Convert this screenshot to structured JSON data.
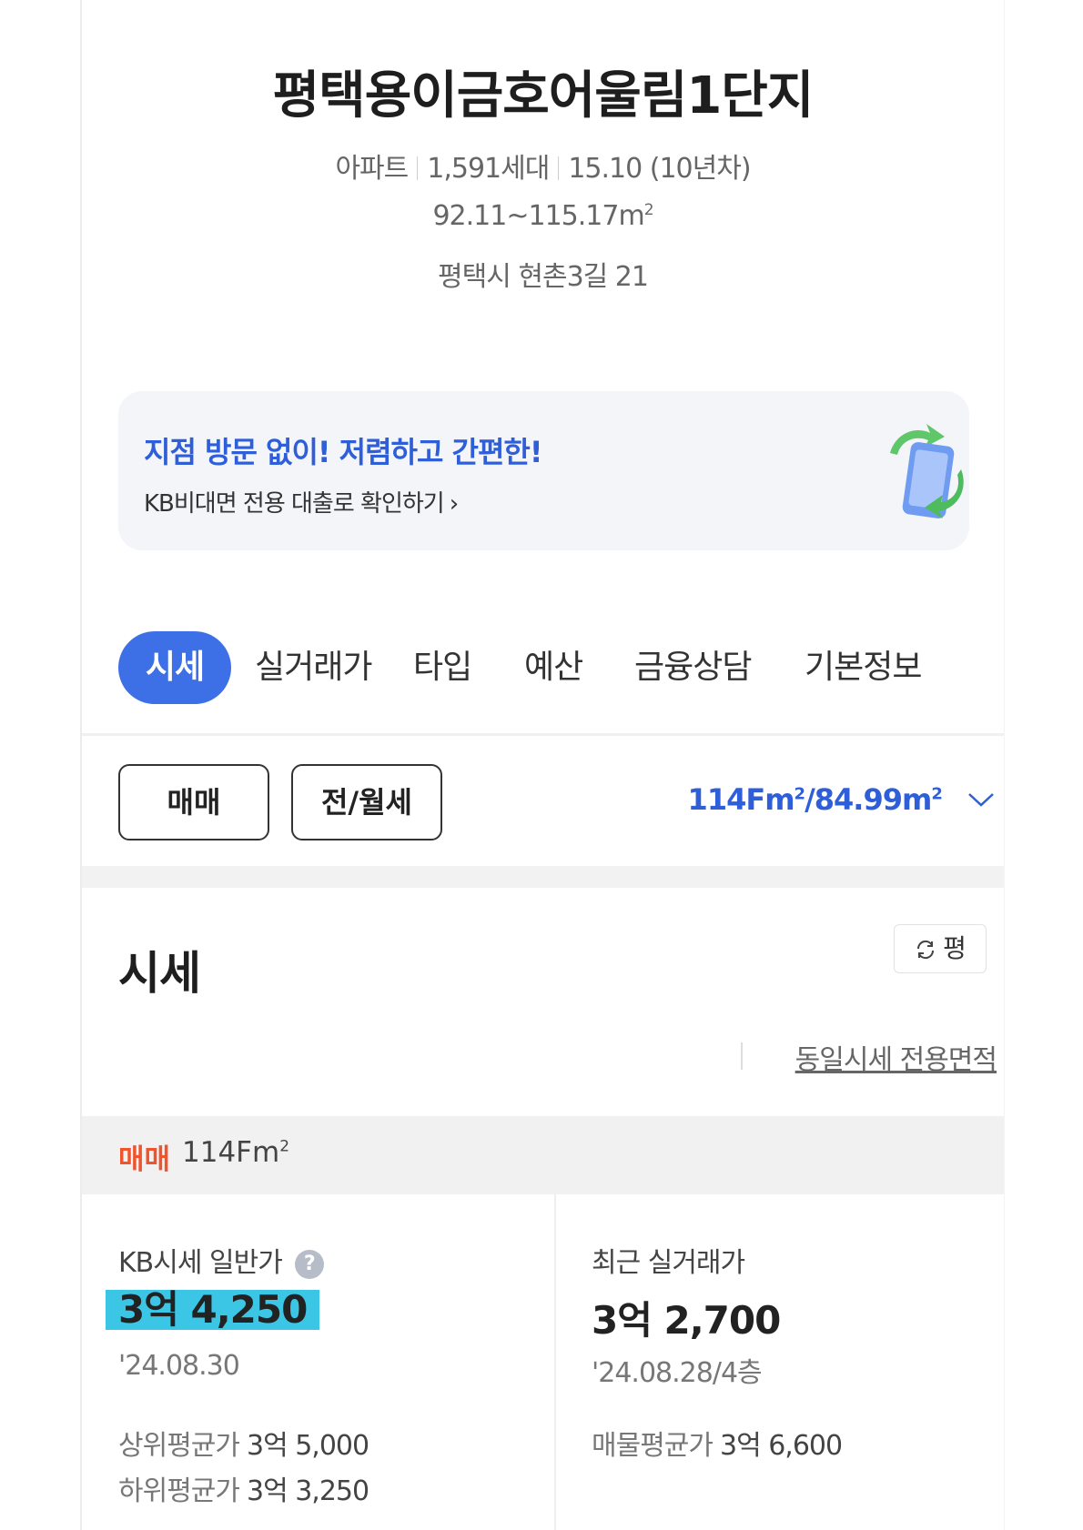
{
  "complex": {
    "name": "평택용이금호어울림1단지",
    "meta": [
      "아파트",
      "1,591세대",
      "15.10 (10년차)"
    ],
    "area_range": "92.11~115.17m",
    "area_unit_sup": "2",
    "address": "평택시 현촌3길 21"
  },
  "banner": {
    "headline": "지점 방문 없이! 저렴하고 간편한!",
    "subline": "KB비대면 전용 대출로 확인하기",
    "chevron": "›",
    "accent_color": "#2f5fd8",
    "illustration": "phone-refresh-icon"
  },
  "tabs": [
    {
      "label": "시세",
      "active": true
    },
    {
      "label": "실거래가",
      "active": false
    },
    {
      "label": "타입",
      "active": false
    },
    {
      "label": "예산",
      "active": false
    },
    {
      "label": "금융상담",
      "active": false
    },
    {
      "label": "기본정보",
      "active": false
    }
  ],
  "deal_types": [
    "매매",
    "전/월세"
  ],
  "area_selector": {
    "value": "114Fm",
    "sup1": "2",
    "value2": "/84.99m",
    "sup2": "2"
  },
  "section": {
    "title": "시세",
    "unit_toggle": "평",
    "same_area_link": "동일시세 전용면적"
  },
  "deal_strip": {
    "label": "매매",
    "area": "114Fm",
    "sup": "2",
    "label_color": "#f0542d"
  },
  "kb_price": {
    "label": "KB시세 일반가",
    "help": "?",
    "value": "3억 4,250",
    "date": "'24.08.30",
    "upper_label": "상위평균가",
    "upper_value": "3억 5,000",
    "lower_label": "하위평균가",
    "lower_value": "3억 3,250"
  },
  "recent_trade": {
    "label": "최근 실거래가",
    "value": "3억 2,700",
    "date": "'24.08.28/4층",
    "listing_label": "매물평균가",
    "listing_value": "3억 6,600"
  }
}
